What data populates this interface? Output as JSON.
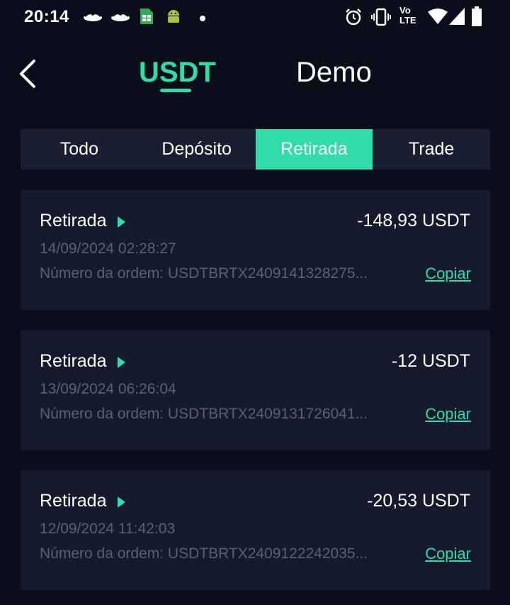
{
  "status_bar": {
    "time": "20:14",
    "left_icons": [
      "handshake-icon",
      "handshake-icon",
      "sheets-icon",
      "android-icon",
      "dot-icon"
    ],
    "right_icons": [
      "alarm-icon",
      "vibrate-icon",
      "volte-icon",
      "wifi-icon",
      "signal-icon",
      "battery-icon"
    ],
    "volte_label_top": "Vo",
    "volte_label_bottom": "LTE"
  },
  "header": {
    "tabs": [
      {
        "label": "USDT",
        "active": true
      },
      {
        "label": "Demo",
        "active": false
      }
    ]
  },
  "filter": {
    "items": [
      {
        "label": "Todo",
        "active": false
      },
      {
        "label": "Depósito",
        "active": false
      },
      {
        "label": "Retirada",
        "active": true
      },
      {
        "label": "Trade",
        "active": false
      }
    ]
  },
  "transactions": [
    {
      "type": "Retirada",
      "amount": "-148,93 USDT",
      "date": "14/09/2024 02:28:27",
      "order": "Número da ordem: USDTBRTX2409141328275...",
      "copy_label": "Copiar"
    },
    {
      "type": "Retirada",
      "amount": "-12 USDT",
      "date": "13/09/2024 06:26:04",
      "order": "Número da ordem: USDTBRTX2409131726041...",
      "copy_label": "Copiar"
    },
    {
      "type": "Retirada",
      "amount": "-20,53 USDT",
      "date": "12/09/2024 11:42:03",
      "order": "Número da ordem: USDTBRTX2409122242035...",
      "copy_label": "Copiar"
    }
  ],
  "colors": {
    "background": "#0a0e1a",
    "accent": "#2fdcaa",
    "card": "#151a2d",
    "segment": "#1a1e31",
    "muted_text": "#5b6072"
  }
}
